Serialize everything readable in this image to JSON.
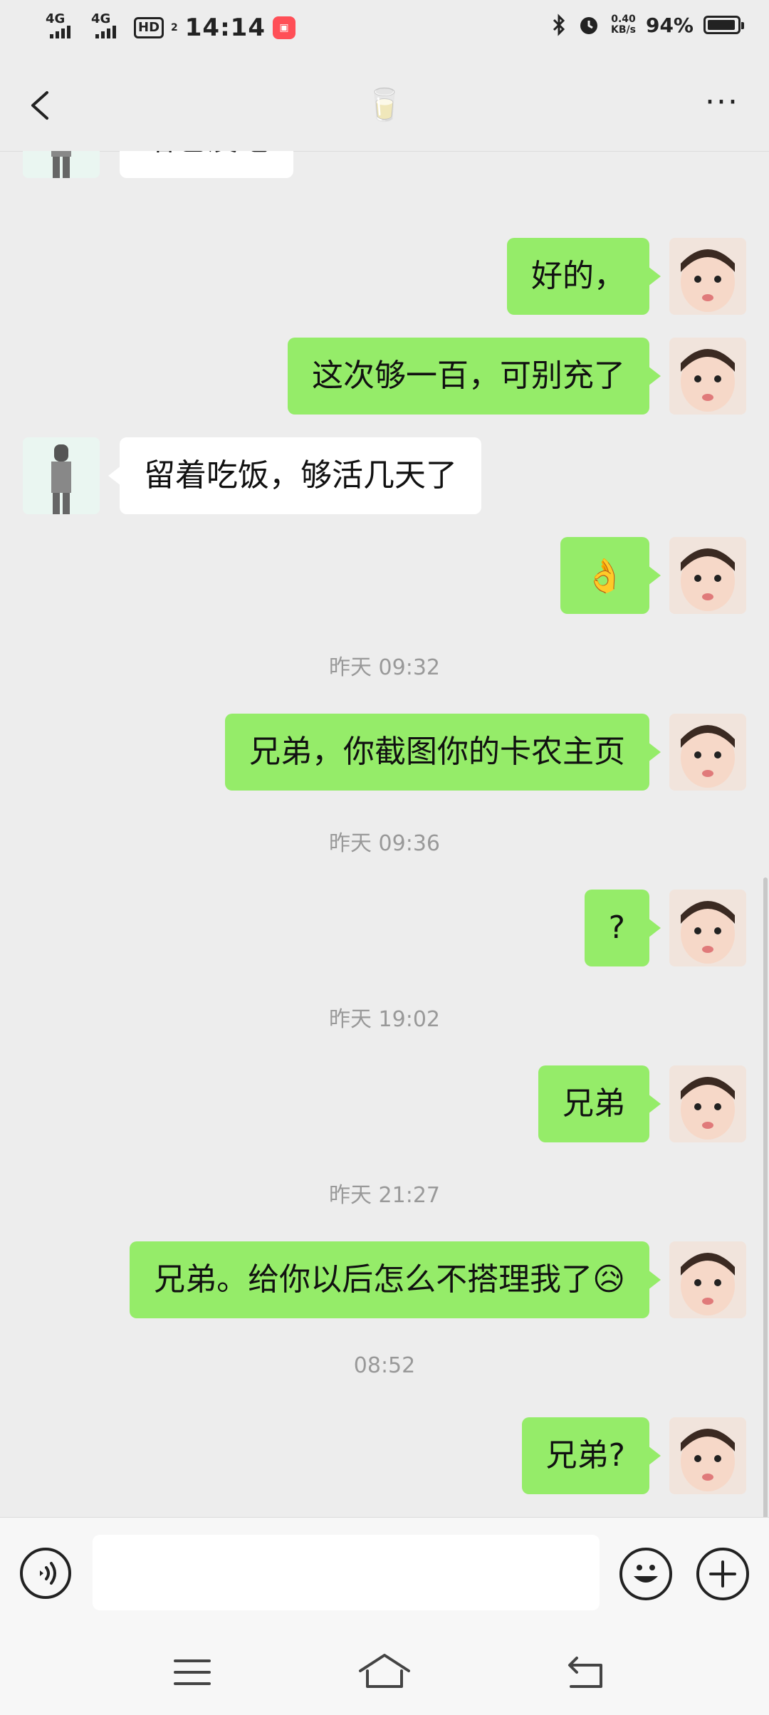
{
  "status_bar": {
    "network_1": "4G",
    "network_2": "4G",
    "hd_label": "HD",
    "hd_sub": "2",
    "time": "14:14",
    "net_speed_value": "0.40",
    "net_speed_unit": "KB/s",
    "battery_percent": "94%",
    "battery_level": 0.94
  },
  "header": {
    "title": "🥛",
    "more_label": "···"
  },
  "messages": [
    {
      "sender": "them",
      "text": "啥也没吃"
    },
    {
      "sender": "me",
      "text": "好的，"
    },
    {
      "sender": "me",
      "text": "这次够一百，可别充了"
    },
    {
      "sender": "them",
      "text": "留着吃饭，够活几天了"
    },
    {
      "sender": "me",
      "text": "👌"
    },
    {
      "timestamp": "昨天 09:32"
    },
    {
      "sender": "me",
      "text": "兄弟，你截图你的卡农主页"
    },
    {
      "timestamp": "昨天 09:36"
    },
    {
      "sender": "me",
      "text": "?"
    },
    {
      "timestamp": "昨天 19:02"
    },
    {
      "sender": "me",
      "text": "兄弟"
    },
    {
      "timestamp": "昨天 21:27"
    },
    {
      "sender": "me",
      "text": "兄弟。给你以后怎么不搭理我了😥"
    },
    {
      "timestamp": "08:52"
    },
    {
      "sender": "me",
      "text": "兄弟?"
    }
  ],
  "input_bar": {
    "value": "",
    "placeholder": ""
  },
  "colors": {
    "my_bubble": "#95ec69",
    "their_bubble": "#ffffff",
    "background": "#ededed"
  }
}
